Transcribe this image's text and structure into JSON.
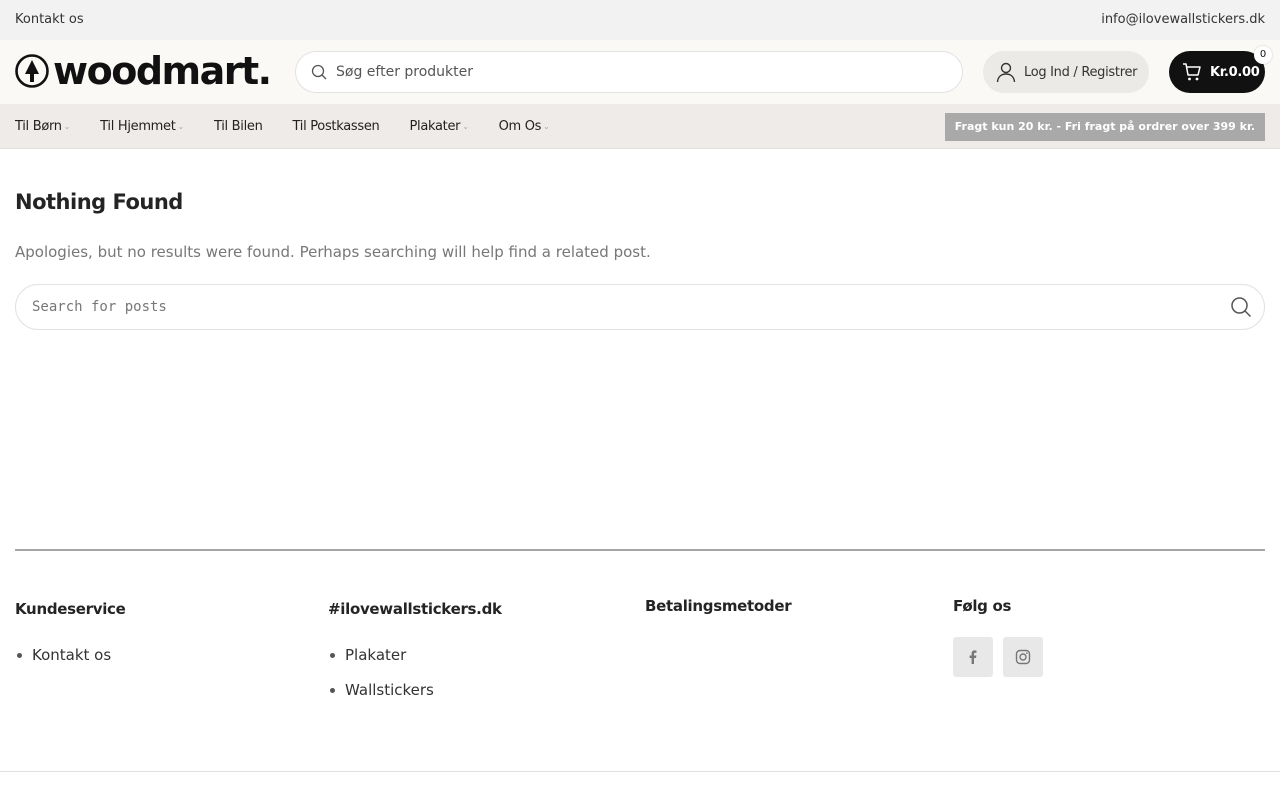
{
  "topbar": {
    "contact": "Kontakt os",
    "email": "info@ilovewallstickers.dk"
  },
  "header": {
    "logo_text": "woodmart.",
    "search_placeholder": "Søg efter produkter",
    "login_label": "Log Ind / Registrer",
    "cart_amount": "Kr.0.00",
    "cart_count": "0"
  },
  "nav": {
    "items": [
      {
        "label": "Til Børn",
        "has_dropdown": true
      },
      {
        "label": "Til Hjemmet",
        "has_dropdown": true
      },
      {
        "label": "Til Bilen",
        "has_dropdown": false
      },
      {
        "label": "Til Postkassen",
        "has_dropdown": false
      },
      {
        "label": "Plakater",
        "has_dropdown": true
      },
      {
        "label": "Om Os",
        "has_dropdown": true
      }
    ],
    "promo": "Fragt kun 20 kr. - Fri fragt på ordrer over 399 kr."
  },
  "main": {
    "title": "Nothing Found",
    "message": "Apologies, but no results were found. Perhaps searching will help find a related post.",
    "search_placeholder": "Search for posts"
  },
  "footer": {
    "col1": {
      "title": "Kundeservice",
      "links": [
        "Kontakt os"
      ]
    },
    "col2": {
      "title": "#ilovewallstickers.dk",
      "links": [
        "Plakater",
        "Wallstickers"
      ]
    },
    "col3": {
      "title": "Betalingsmetoder"
    },
    "col4": {
      "title": "Følg os",
      "icons": [
        "facebook-icon",
        "instagram-icon"
      ]
    }
  },
  "colors": {
    "topbar_bg": "#f2f2f2",
    "header_bg": "#faf9f5",
    "nav_bg": "#efebe8",
    "cart_bg": "#111111",
    "promo_bg": "#a9a9a9"
  }
}
